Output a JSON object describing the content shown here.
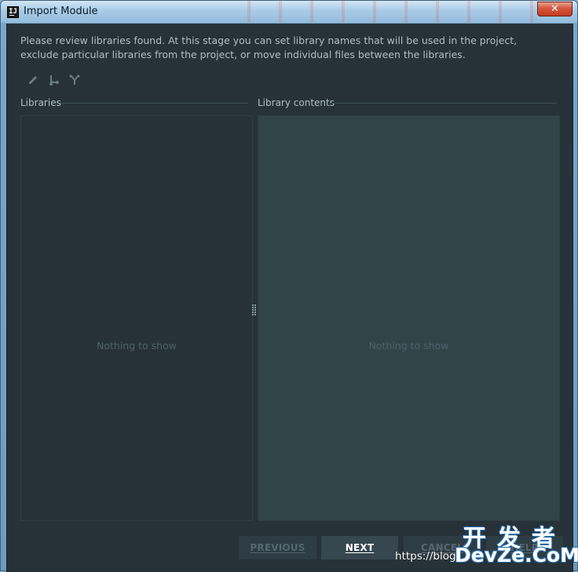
{
  "window": {
    "title": "Import Module",
    "app_icon_text": "IJ",
    "close_glyph": "✕"
  },
  "description": {
    "line1": "Please review libraries found. At this stage you can set library names that will be used in the project,",
    "line2": "exclude particular libraries from the project, or move individual files between the libraries."
  },
  "toolbar": {
    "items": [
      {
        "icon": "pencil-icon"
      },
      {
        "icon": "split-icon"
      },
      {
        "icon": "merge-icon"
      }
    ]
  },
  "libraries": {
    "label": "Libraries",
    "empty_text": "Nothing to show"
  },
  "library_contents": {
    "label": "Library contents",
    "empty_text": "Nothing to show"
  },
  "buttons": {
    "previous": "PREVIOUS",
    "next": "NEXT",
    "cancel": "CANCEL",
    "help": "HELP"
  },
  "watermark": {
    "cn": "开发者",
    "en": "DevZe.CoM",
    "url": "https://blog"
  },
  "colors": {
    "background": "#263238",
    "right_panel": "#314549",
    "text": "#b0bec5",
    "muted": "#4c6068",
    "next_button": "#37474f"
  }
}
